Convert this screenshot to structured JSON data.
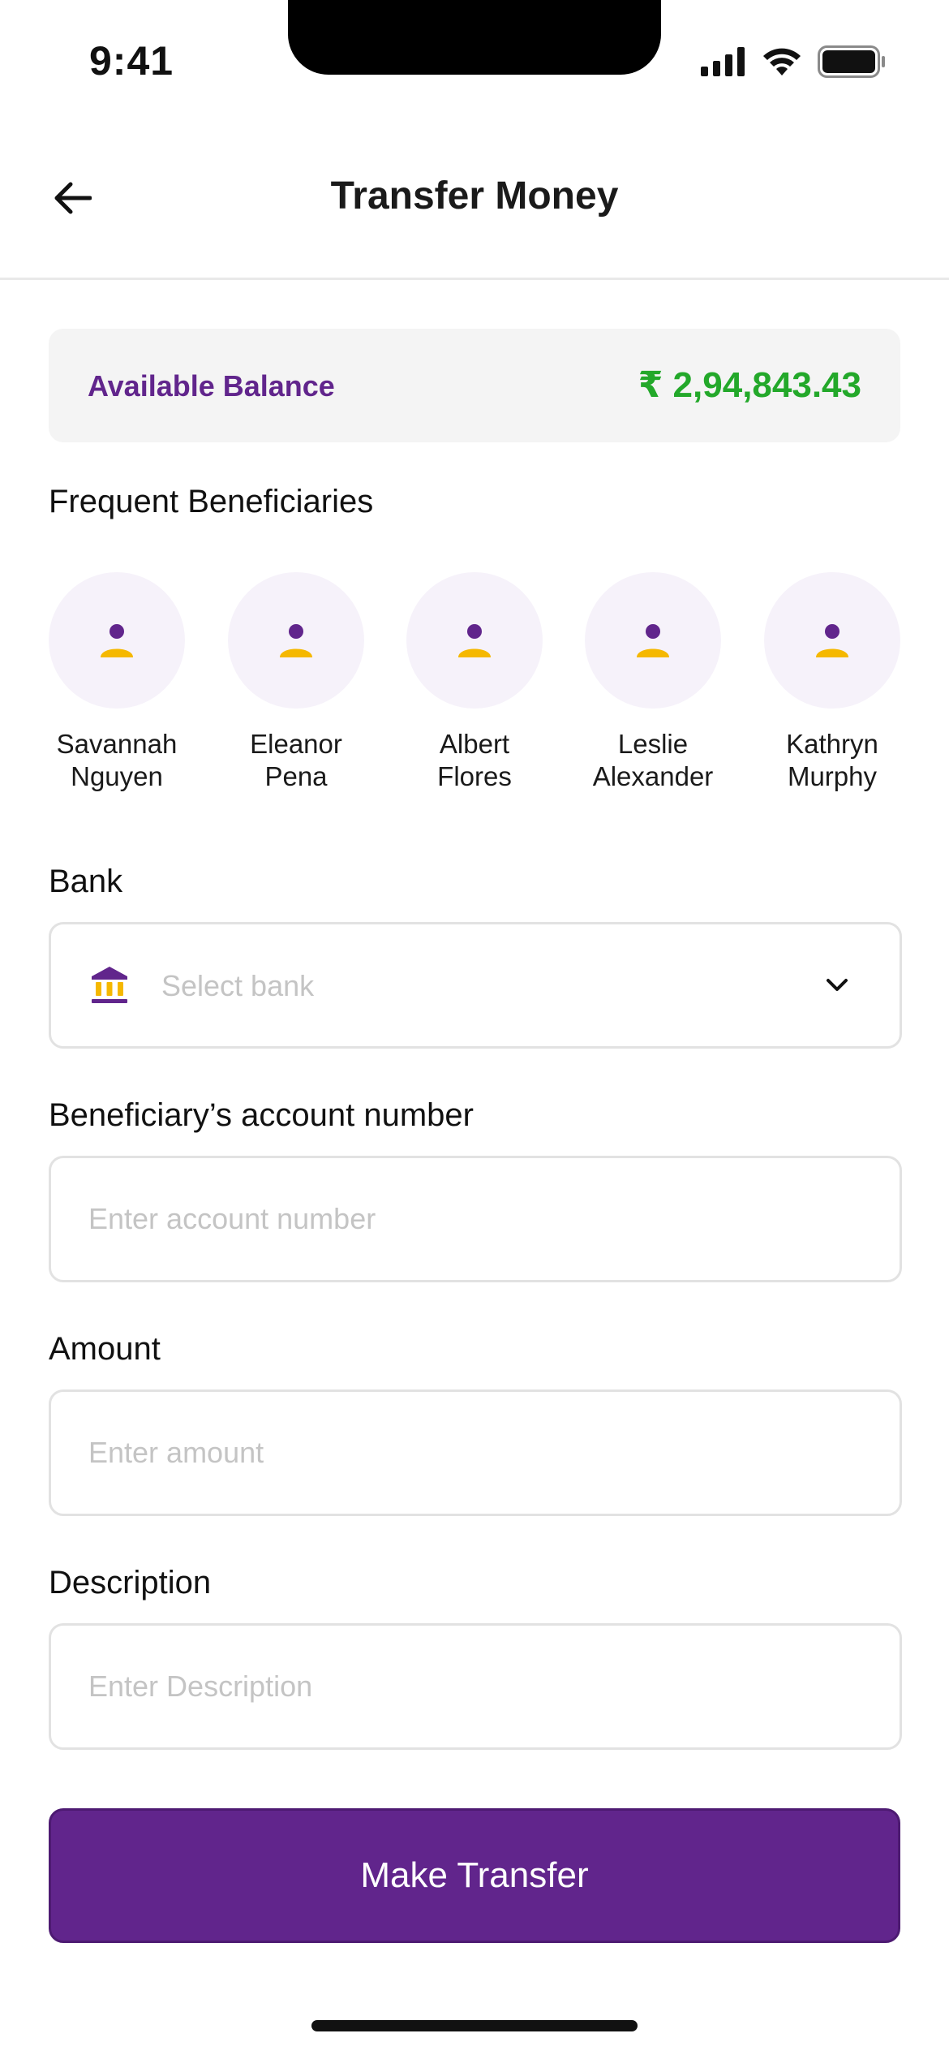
{
  "status_bar": {
    "time": "9:41",
    "icons": [
      "signal-icon",
      "wifi-icon",
      "battery-icon"
    ]
  },
  "header": {
    "title": "Transfer Money",
    "back_icon": "arrow-left-icon"
  },
  "balance": {
    "label": "Available Balance",
    "value": "₹ 2,94,843.43"
  },
  "beneficiaries": {
    "heading": "Frequent Beneficiaries",
    "items": [
      {
        "name": "Savannah\nNguyen"
      },
      {
        "name": "Eleanor\nPena"
      },
      {
        "name": "Albert\nFlores"
      },
      {
        "name": "Leslie\nAlexander"
      },
      {
        "name": "Kathryn\nMurphy"
      }
    ]
  },
  "form": {
    "bank": {
      "label": "Bank",
      "placeholder": "Select bank",
      "icon": "bank-icon"
    },
    "account": {
      "label": "Beneficiary’s account number",
      "placeholder": "Enter account number"
    },
    "amount": {
      "label": "Amount",
      "placeholder": "Enter amount"
    },
    "description": {
      "label": "Description",
      "placeholder": "Enter Description"
    }
  },
  "submit_label": "Make Transfer",
  "colors": {
    "primary": "#61258c",
    "balance_value": "#23a82a",
    "avatar_bg": "#f6f2fa",
    "avatar_accent": "#f5b800",
    "card_bg": "#f4f4f4"
  }
}
